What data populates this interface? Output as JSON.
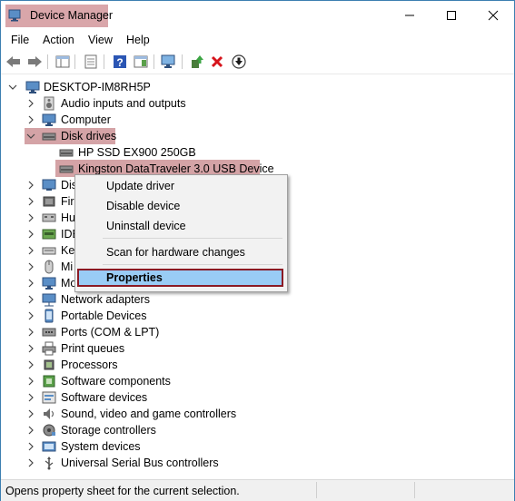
{
  "window": {
    "title": "Device Manager",
    "minimize": "minimize",
    "maximize": "maximize",
    "close": "close"
  },
  "menu": [
    "File",
    "Action",
    "View",
    "Help"
  ],
  "tree": {
    "root": "DESKTOP-IM8RH5P",
    "categories": [
      {
        "label": "Audio inputs and outputs",
        "icon": "speaker-icon"
      },
      {
        "label": "Computer",
        "icon": "monitor-icon"
      },
      {
        "label": "Disk drives",
        "icon": "disk-drive-icon",
        "expanded": true
      },
      {
        "label": "Disk",
        "icon": "display-adapter-icon"
      },
      {
        "label": "Firm",
        "icon": "firmware-icon"
      },
      {
        "label": "Hu",
        "icon": "hid-icon"
      },
      {
        "label": "IDE",
        "icon": "ide-icon"
      },
      {
        "label": "Key",
        "icon": "keyboard-icon"
      },
      {
        "label": "Mi",
        "icon": "mouse-icon"
      },
      {
        "label": "Mo",
        "icon": "monitor-icon"
      },
      {
        "label": "Network adapters",
        "icon": "network-icon"
      },
      {
        "label": "Portable Devices",
        "icon": "portable-device-icon"
      },
      {
        "label": "Ports (COM & LPT)",
        "icon": "port-icon"
      },
      {
        "label": "Print queues",
        "icon": "printer-icon"
      },
      {
        "label": "Processors",
        "icon": "processor-icon"
      },
      {
        "label": "Software components",
        "icon": "software-component-icon"
      },
      {
        "label": "Software devices",
        "icon": "software-device-icon"
      },
      {
        "label": "Sound, video and game controllers",
        "icon": "sound-icon"
      },
      {
        "label": "Storage controllers",
        "icon": "storage-controller-icon"
      },
      {
        "label": "System devices",
        "icon": "system-device-icon"
      },
      {
        "label": "Universal Serial Bus controllers",
        "icon": "usb-icon"
      }
    ],
    "disk_children": [
      "HP SSD EX900 250GB",
      "Kingston DataTraveler 3.0 USB Device"
    ]
  },
  "context_menu": {
    "update": "Update driver",
    "disable": "Disable device",
    "uninstall": "Uninstall device",
    "scan": "Scan for hardware changes",
    "properties": "Properties"
  },
  "status": "Opens property sheet for the current selection.",
  "colors": {
    "highlight": "#d4a3a6",
    "menu_selection": "#99ccf5",
    "selection_border": "#8b1a24"
  }
}
